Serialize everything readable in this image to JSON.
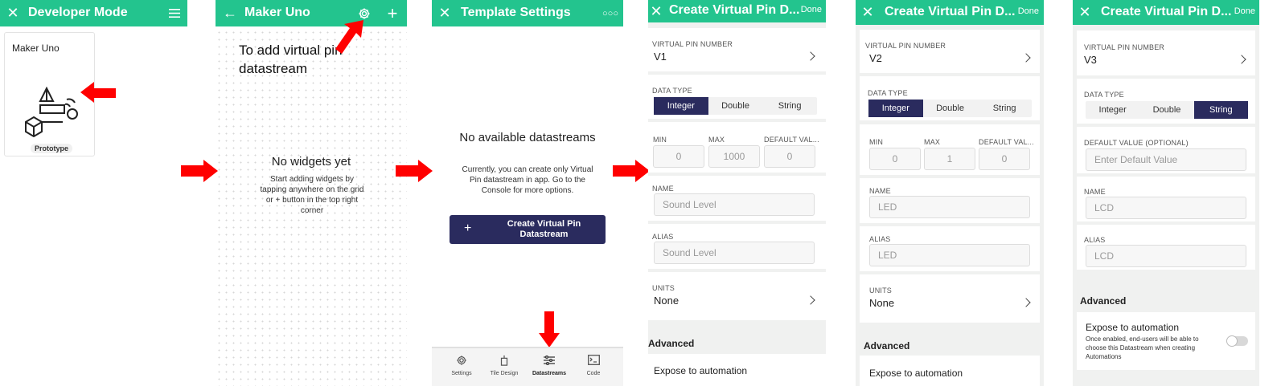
{
  "colors": {
    "brand": "#23c48e",
    "arrow": "#ff0000",
    "selected": "#2a2b5e"
  },
  "panel1": {
    "title": "Developer Mode",
    "card_title": "Maker Uno",
    "card_badge": "Prototype"
  },
  "panel2": {
    "title": "Maker Uno",
    "annotation": "To add virtual pin datastream",
    "empty_title": "No widgets yet",
    "empty_body": "Start adding widgets by tapping anywhere on the grid or + button in the top right corner"
  },
  "panel3": {
    "title": "Template Settings",
    "empty_title": "No available datastreams",
    "empty_body": "Currently, you can create only Virtual Pin datastream in app. Go to the Console for more options.",
    "create_button": "Create Virtual Pin Datastream",
    "nav": [
      {
        "label": "Settings",
        "icon": "gear-icon"
      },
      {
        "label": "Tile Design",
        "icon": "tile-design-icon"
      },
      {
        "label": "Datastreams",
        "icon": "datastreams-icon"
      },
      {
        "label": "Code",
        "icon": "code-icon"
      }
    ]
  },
  "panel4": {
    "title": "Create Virtual Pin D...",
    "done": "Done",
    "pin_label": "VIRTUAL PIN NUMBER",
    "pin_value": "V1",
    "data_type_label": "DATA TYPE",
    "types": [
      "Integer",
      "Double",
      "String"
    ],
    "selected_type": "Integer",
    "min_label": "MIN",
    "max_label": "MAX",
    "default_label": "DEFAULT VAL...",
    "min_value": "0",
    "max_value": "1000",
    "default_value": "0",
    "name_label": "NAME",
    "name_value": "Sound Level",
    "alias_label": "ALIAS",
    "alias_value": "Sound Level",
    "units_label": "UNITS",
    "units_value": "None",
    "advanced": "Advanced",
    "expose": "Expose to automation"
  },
  "panel5": {
    "title": "Create Virtual Pin D...",
    "done": "Done",
    "pin_label": "VIRTUAL PIN NUMBER",
    "pin_value": "V2",
    "data_type_label": "DATA TYPE",
    "types": [
      "Integer",
      "Double",
      "String"
    ],
    "selected_type": "Integer",
    "min_label": "MIN",
    "max_label": "MAX",
    "default_label": "DEFAULT VAL...",
    "min_value": "0",
    "max_value": "1",
    "default_value": "0",
    "name_label": "NAME",
    "name_value": "LED",
    "alias_label": "ALIAS",
    "alias_value": "LED",
    "units_label": "UNITS",
    "units_value": "None",
    "advanced": "Advanced",
    "expose": "Expose to automation"
  },
  "panel6": {
    "title": "Create Virtual Pin D...",
    "done": "Done",
    "pin_label": "VIRTUAL PIN NUMBER",
    "pin_value": "V3",
    "data_type_label": "DATA TYPE",
    "types": [
      "Integer",
      "Double",
      "String"
    ],
    "selected_type": "String",
    "default_label": "DEFAULT VALUE (OPTIONAL)",
    "default_placeholder": "Enter Default Value",
    "name_label": "NAME",
    "name_value": "LCD",
    "alias_label": "ALIAS",
    "alias_value": "LCD",
    "advanced": "Advanced",
    "expose": "Expose to automation",
    "expose_desc": "Once enabled, end-users will be able to choose this Datastream when creating Automations",
    "expose_toggle_on": false
  }
}
